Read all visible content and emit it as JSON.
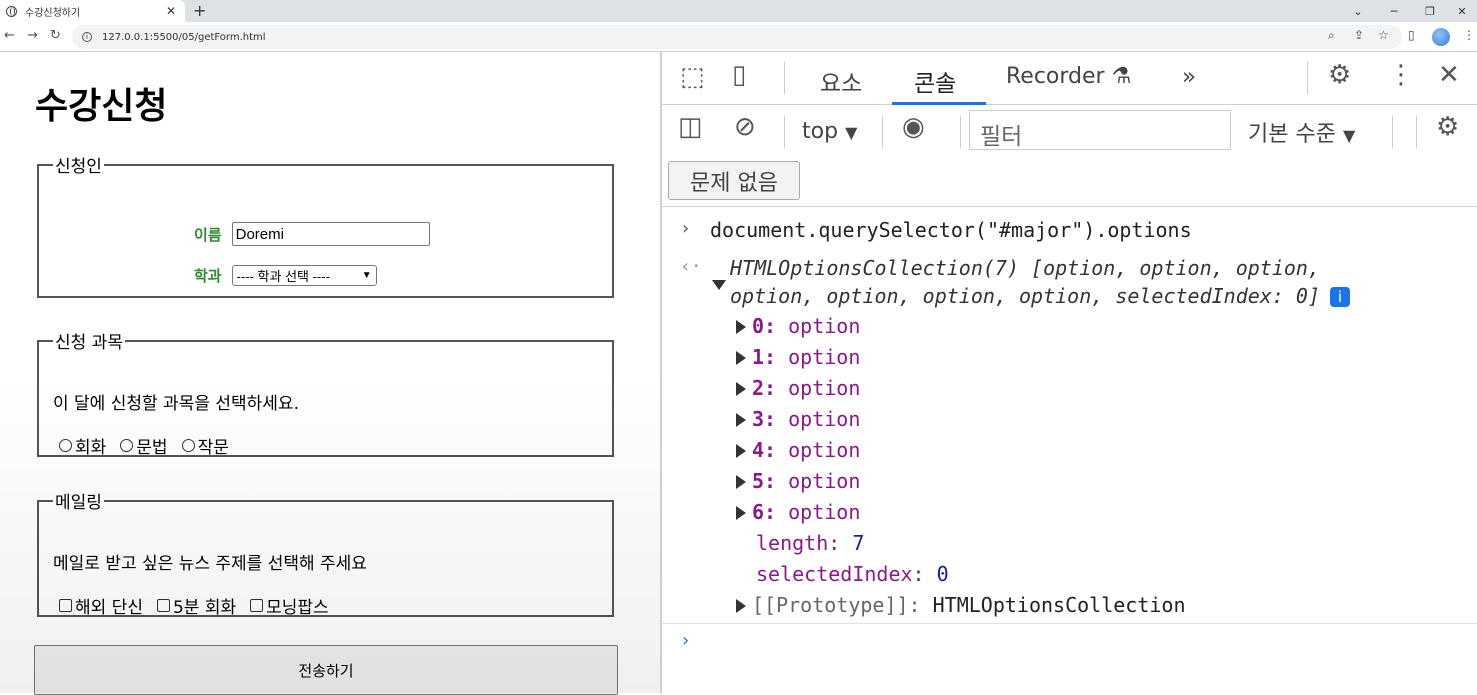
{
  "browser": {
    "tab_title": "수강신청하기",
    "tab_close": "✕",
    "new_tab": "+",
    "url": "127.0.0.1:5500/05/getForm.html"
  },
  "page": {
    "title": "수강신청",
    "applicant": {
      "legend": "신청인",
      "name_label": "이름",
      "name_value": "Doremi",
      "major_label": "학과",
      "major_selected": "---- 학과 선택 ----"
    },
    "courses": {
      "legend": "신청 과목",
      "description": "이 달에 신청할 과목을 선택하세요.",
      "options": [
        "회화",
        "문법",
        "작문"
      ]
    },
    "mailing": {
      "legend": "메일링",
      "description": "메일로 받고 싶은 뉴스 주제를 선택해 주세요",
      "options": [
        "해외 단신",
        "5분 회화",
        "모닝팝스"
      ]
    },
    "submit_label": "전송하기"
  },
  "devtools": {
    "tabs": [
      "요소",
      "콘솔",
      "Recorder"
    ],
    "active_tab": "콘솔",
    "more_tabs": "»",
    "context": "top",
    "filter_placeholder": "필터",
    "level": "기본 수준",
    "issues": "문제 없음",
    "console": {
      "command": "document.querySelector(\"#major\").options",
      "result_line1": "HTMLOptionsCollection(7) [option, option, option,",
      "result_line2": "option, option, option, option, selectedIndex: 0]",
      "info_badge": "i",
      "items": [
        {
          "key": "0",
          "value": "option"
        },
        {
          "key": "1",
          "value": "option"
        },
        {
          "key": "2",
          "value": "option"
        },
        {
          "key": "3",
          "value": "option"
        },
        {
          "key": "4",
          "value": "option"
        },
        {
          "key": "5",
          "value": "option"
        },
        {
          "key": "6",
          "value": "option"
        }
      ],
      "length_key": "length",
      "length_value": "7",
      "selected_key": "selectedIndex",
      "selected_value": "0",
      "prototype_key": "[[Prototype]]",
      "prototype_value": "HTMLOptionsCollection"
    }
  },
  "colors": {
    "label_green": "#2e8b2e",
    "devtools_accent": "#1a73e8",
    "console_key_purple": "#8a1a8a"
  }
}
